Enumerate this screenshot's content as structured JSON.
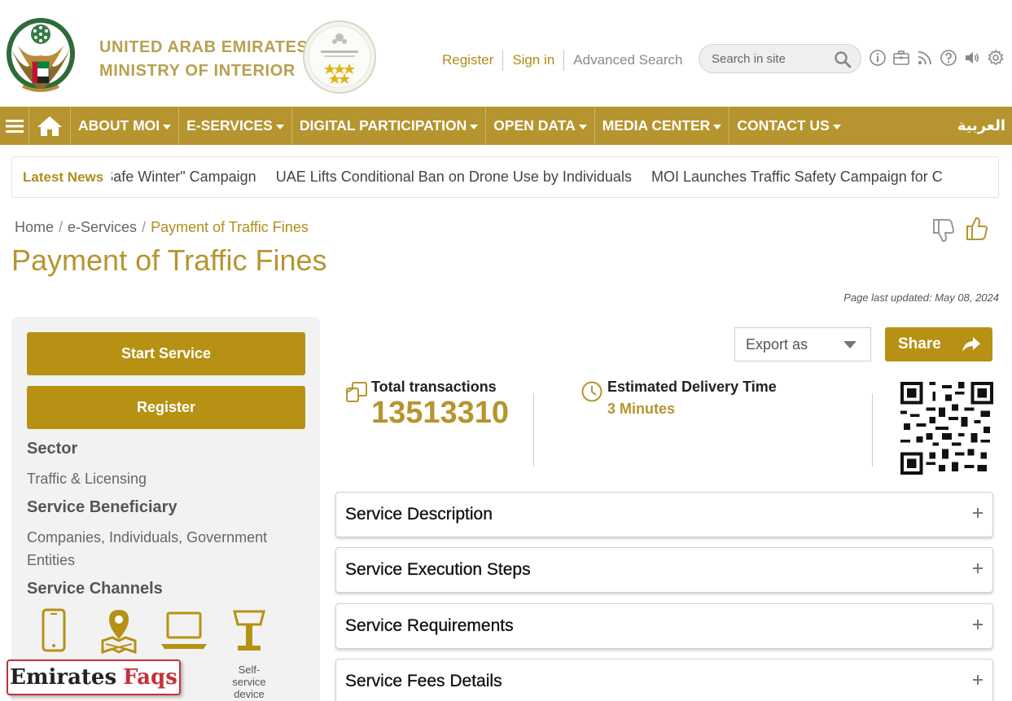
{
  "header": {
    "ministry_line1": "UNITED ARAB EMIRATES",
    "ministry_line2": "MINISTRY OF INTERIOR",
    "links": {
      "register": "Register",
      "sign_in": "Sign in",
      "advanced_search": "Advanced Search"
    },
    "search": {
      "placeholder": "Search in site"
    },
    "icons": [
      "info-icon",
      "briefcase-icon",
      "rss-icon",
      "help-icon",
      "volume-icon",
      "settings-icon"
    ]
  },
  "nav": {
    "items": [
      {
        "label": "ABOUT MOI"
      },
      {
        "label": "E-SERVICES"
      },
      {
        "label": "DIGITAL PARTICIPATION"
      },
      {
        "label": "OPEN DATA"
      },
      {
        "label": "MEDIA CENTER"
      },
      {
        "label": "CONTACT US"
      }
    ],
    "language": "العربية"
  },
  "news": {
    "label": "Latest News",
    "items": [
      "Safe Winter\" Campaign",
      "UAE Lifts Conditional Ban on Drone Use by Individuals",
      "MOI Launches Traffic Safety Campaign for C"
    ]
  },
  "breadcrumb": {
    "home": "Home",
    "section": "e-Services",
    "current": "Payment of Traffic Fines"
  },
  "page": {
    "title": "Payment of Traffic Fines",
    "last_updated": "Page last updated: May 08, 2024"
  },
  "sidebar": {
    "start_service": "Start Service",
    "register": "Register",
    "sector_heading": "Sector",
    "sector_value": "Traffic & Licensing",
    "beneficiary_heading": "Service Beneficiary",
    "beneficiary_value": "Companies, Individuals, Government Entities",
    "channels_heading": "Service Channels",
    "channels": [
      {
        "icon": "smartphone-icon",
        "label": ""
      },
      {
        "icon": "location-pin-icon",
        "label": ""
      },
      {
        "icon": "laptop-icon",
        "label": ""
      },
      {
        "icon": "kiosk-icon",
        "label": "Self-service device"
      }
    ]
  },
  "actions": {
    "export_label": "Export as",
    "share_label": "Share"
  },
  "stats": {
    "total_label": "Total transactions",
    "total_value": "13513310",
    "delivery_label": "Estimated Delivery Time",
    "delivery_value": "3 Minutes"
  },
  "accordions": [
    "Service Description",
    "Service Execution Steps",
    "Service Requirements",
    "Service Fees Details"
  ],
  "watermark": {
    "part1": "Emirates",
    "part2": "Faqs"
  },
  "colors": {
    "gold": "#b69530",
    "button_gold": "#b69114",
    "watermark_red": "#c4323a"
  }
}
